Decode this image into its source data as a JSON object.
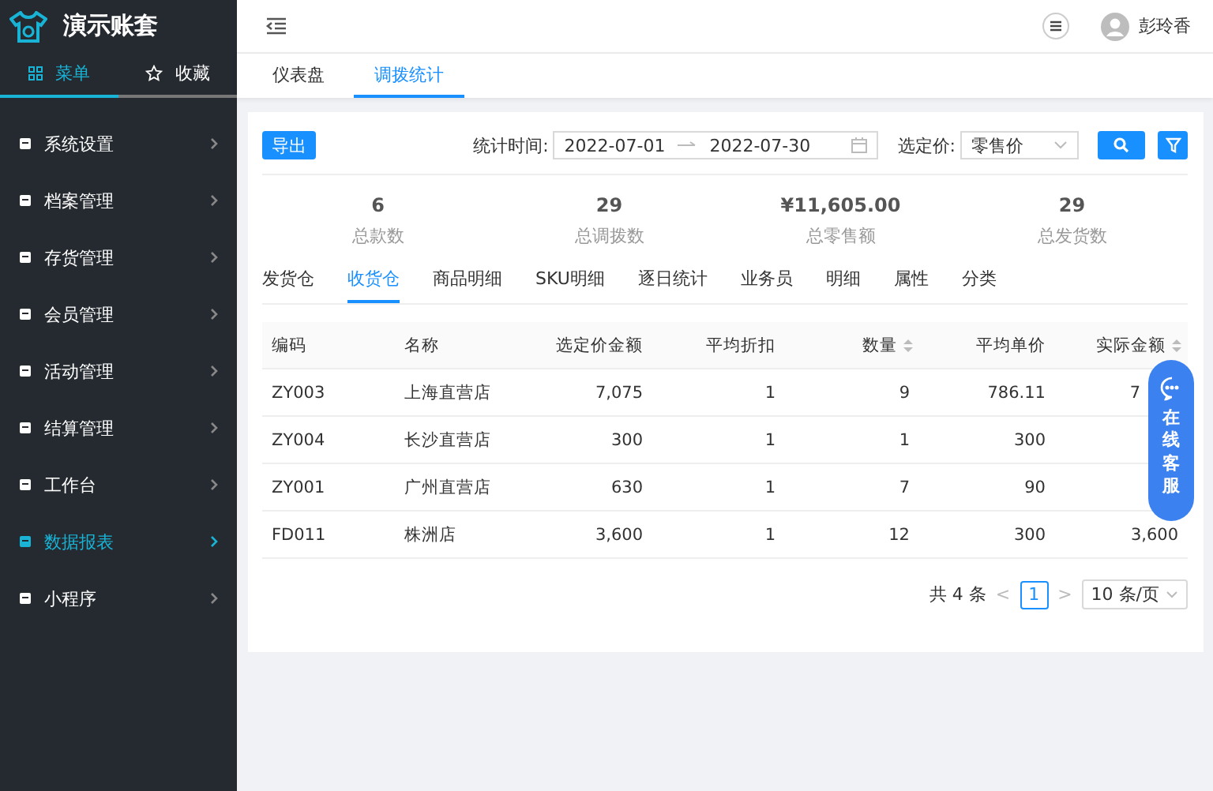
{
  "sidebar": {
    "brand": "演示账套",
    "tabs": [
      {
        "label": "菜单",
        "selected": true
      },
      {
        "label": "收藏",
        "selected": false
      }
    ],
    "items": [
      {
        "label": "系统设置",
        "selected": false
      },
      {
        "label": "档案管理",
        "selected": false
      },
      {
        "label": "存货管理",
        "selected": false
      },
      {
        "label": "会员管理",
        "selected": false
      },
      {
        "label": "活动管理",
        "selected": false
      },
      {
        "label": "结算管理",
        "selected": false
      },
      {
        "label": "工作台",
        "selected": false
      },
      {
        "label": "数据报表",
        "selected": true
      },
      {
        "label": "小程序",
        "selected": false
      }
    ]
  },
  "header": {
    "user": "彭玲香"
  },
  "page_tabs": [
    {
      "label": "仪表盘",
      "selected": false
    },
    {
      "label": "调拨统计",
      "selected": true
    }
  ],
  "toolbar": {
    "export": "导出",
    "date_label": "统计时间:",
    "date_from": "2022-07-01",
    "date_to": "2022-07-30",
    "price_label": "选定价:",
    "price_value": "零售价"
  },
  "stats": [
    {
      "value": "6",
      "label": "总款数"
    },
    {
      "value": "29",
      "label": "总调拨数"
    },
    {
      "value": "¥11,605.00",
      "label": "总零售额"
    },
    {
      "value": "29",
      "label": "总发货数"
    }
  ],
  "sub_tabs": [
    {
      "label": "发货仓",
      "selected": false
    },
    {
      "label": "收货仓",
      "selected": true
    },
    {
      "label": "商品明细",
      "selected": false
    },
    {
      "label": "SKU明细",
      "selected": false
    },
    {
      "label": "逐日统计",
      "selected": false
    },
    {
      "label": "业务员",
      "selected": false
    },
    {
      "label": "明细",
      "selected": false
    },
    {
      "label": "属性",
      "selected": false
    },
    {
      "label": "分类",
      "selected": false
    }
  ],
  "table": {
    "columns": [
      {
        "label": "编码",
        "sortable": false
      },
      {
        "label": "名称",
        "sortable": false
      },
      {
        "label": "选定价金额",
        "sortable": false
      },
      {
        "label": "平均折扣",
        "sortable": false
      },
      {
        "label": "数量",
        "sortable": true
      },
      {
        "label": "平均单价",
        "sortable": false
      },
      {
        "label": "实际金额",
        "sortable": true
      }
    ],
    "rows": [
      {
        "cells": [
          "ZY003",
          "上海直营店",
          "7,075",
          "1",
          "9",
          "786.11",
          "7"
        ],
        "last_cut": true
      },
      {
        "cells": [
          "ZY004",
          "长沙直营店",
          "300",
          "1",
          "1",
          "300",
          null
        ]
      },
      {
        "cells": [
          "ZY001",
          "广州直营店",
          "630",
          "1",
          "7",
          "90",
          null
        ]
      },
      {
        "cells": [
          "FD011",
          "株洲店",
          "3,600",
          "1",
          "12",
          "300",
          "3,600"
        ]
      }
    ]
  },
  "pagination": {
    "total": "共 4 条",
    "prev": "<",
    "pages": [
      {
        "label": "1",
        "selected": true
      }
    ],
    "next": ">",
    "page_size": "10 条/页"
  },
  "chat_widget": {
    "label": "在线客服"
  }
}
